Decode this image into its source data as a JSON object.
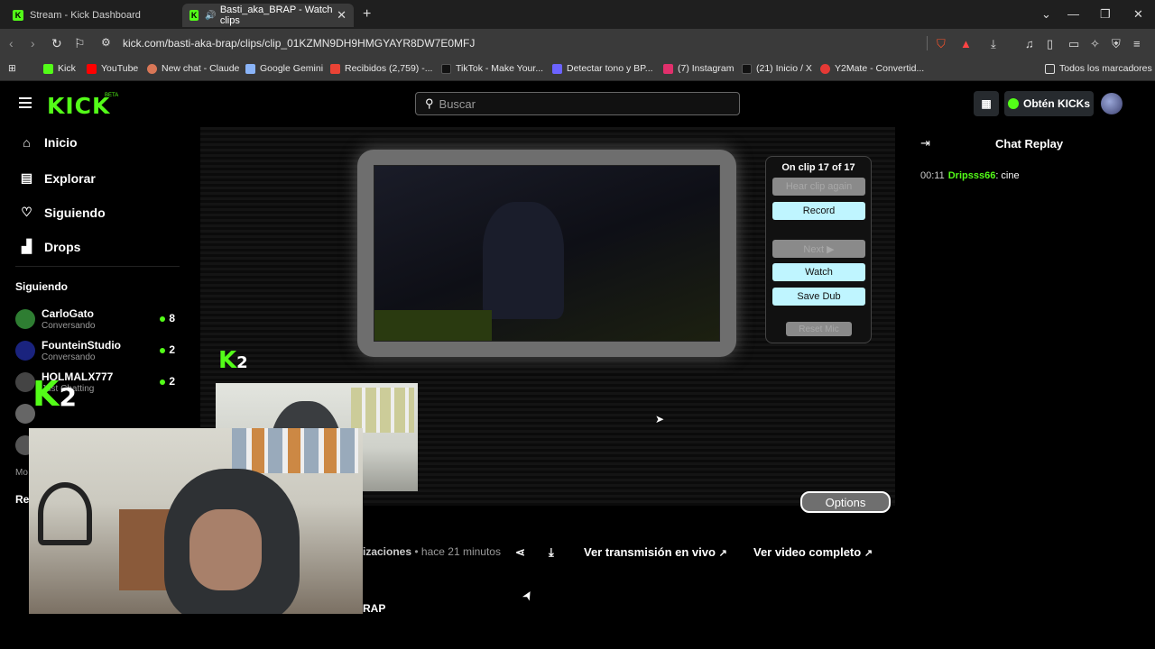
{
  "browser": {
    "tabs": [
      {
        "title": "Stream - Kick Dashboard",
        "active": false
      },
      {
        "title": "Basti_aka_BRAP - Watch clips",
        "active": true
      }
    ],
    "new_tab": "+",
    "url": "kick.com/basti-aka-brap/clips/clip_01KZMN9DH9HMGYAYR8DW7E0MFJ",
    "bookmarks": [
      {
        "label": "Kick",
        "color": "#53fc18"
      },
      {
        "label": "YouTube",
        "color": "#ff0000"
      },
      {
        "label": "New chat - Claude",
        "color": "#d97757"
      },
      {
        "label": "Google Gemini",
        "color": "#8ab4f8"
      },
      {
        "label": "Recibidos (2,759) -...",
        "color": "#ea4335"
      },
      {
        "label": "TikTok - Make Your...",
        "color": "#111111"
      },
      {
        "label": "Detectar tono y BP...",
        "color": "#6c63ff"
      },
      {
        "label": "(7) Instagram",
        "color": "#e1306c"
      },
      {
        "label": "(21) Inicio / X",
        "color": "#111111"
      },
      {
        "label": "Y2Mate - Convertid...",
        "color": "#e53935"
      }
    ],
    "all_bookmarks": "Todos los marcadores"
  },
  "header": {
    "logo": "KICK",
    "beta": "BETA",
    "search_placeholder": "Buscar",
    "get_kicks": "Obtén KICKs"
  },
  "sidebar": {
    "nav": [
      {
        "label": "Inicio",
        "icon": "home-icon"
      },
      {
        "label": "Explorar",
        "icon": "browse-icon"
      },
      {
        "label": "Siguiendo",
        "icon": "heart-icon"
      },
      {
        "label": "Drops",
        "icon": "drops-icon"
      }
    ],
    "following_header": "Siguiendo",
    "following": [
      {
        "name": "CarloGato",
        "status": "Conversando",
        "viewers": "8",
        "color": "#2e7d32"
      },
      {
        "name": "FounteinStudio",
        "status": "Conversando",
        "viewers": "2",
        "color": "#1a237e"
      },
      {
        "name": "HOLMALX777",
        "status": "Just Chatting",
        "viewers": "2",
        "color": "#444444"
      }
    ],
    "partial_labels": [
      "Mo",
      "Re"
    ]
  },
  "clip_panel": {
    "header": "On clip 17 of 17",
    "buttons": [
      {
        "label": "Hear clip again",
        "enabled": false
      },
      {
        "label": "Record",
        "enabled": true
      },
      {
        "label": "Next ▶",
        "enabled": false
      },
      {
        "label": "Watch",
        "enabled": true
      },
      {
        "label": "Save Dub",
        "enabled": true
      },
      {
        "label": "Reset Mic",
        "enabled": false
      }
    ],
    "options": "Options"
  },
  "overlay": {
    "k_label": "K",
    "k_count": "2"
  },
  "clip_meta": {
    "views_partial": "izaciones",
    "time": "• hace 21 minutos",
    "live_button": "Ver transmisión en vivo",
    "full_video_button": "Ver video completo",
    "channel_partial": "RAP"
  },
  "chat": {
    "title": "Chat Replay",
    "messages": [
      {
        "time": "00:11",
        "user": "Dripsss66",
        "text": ": cine"
      }
    ]
  }
}
